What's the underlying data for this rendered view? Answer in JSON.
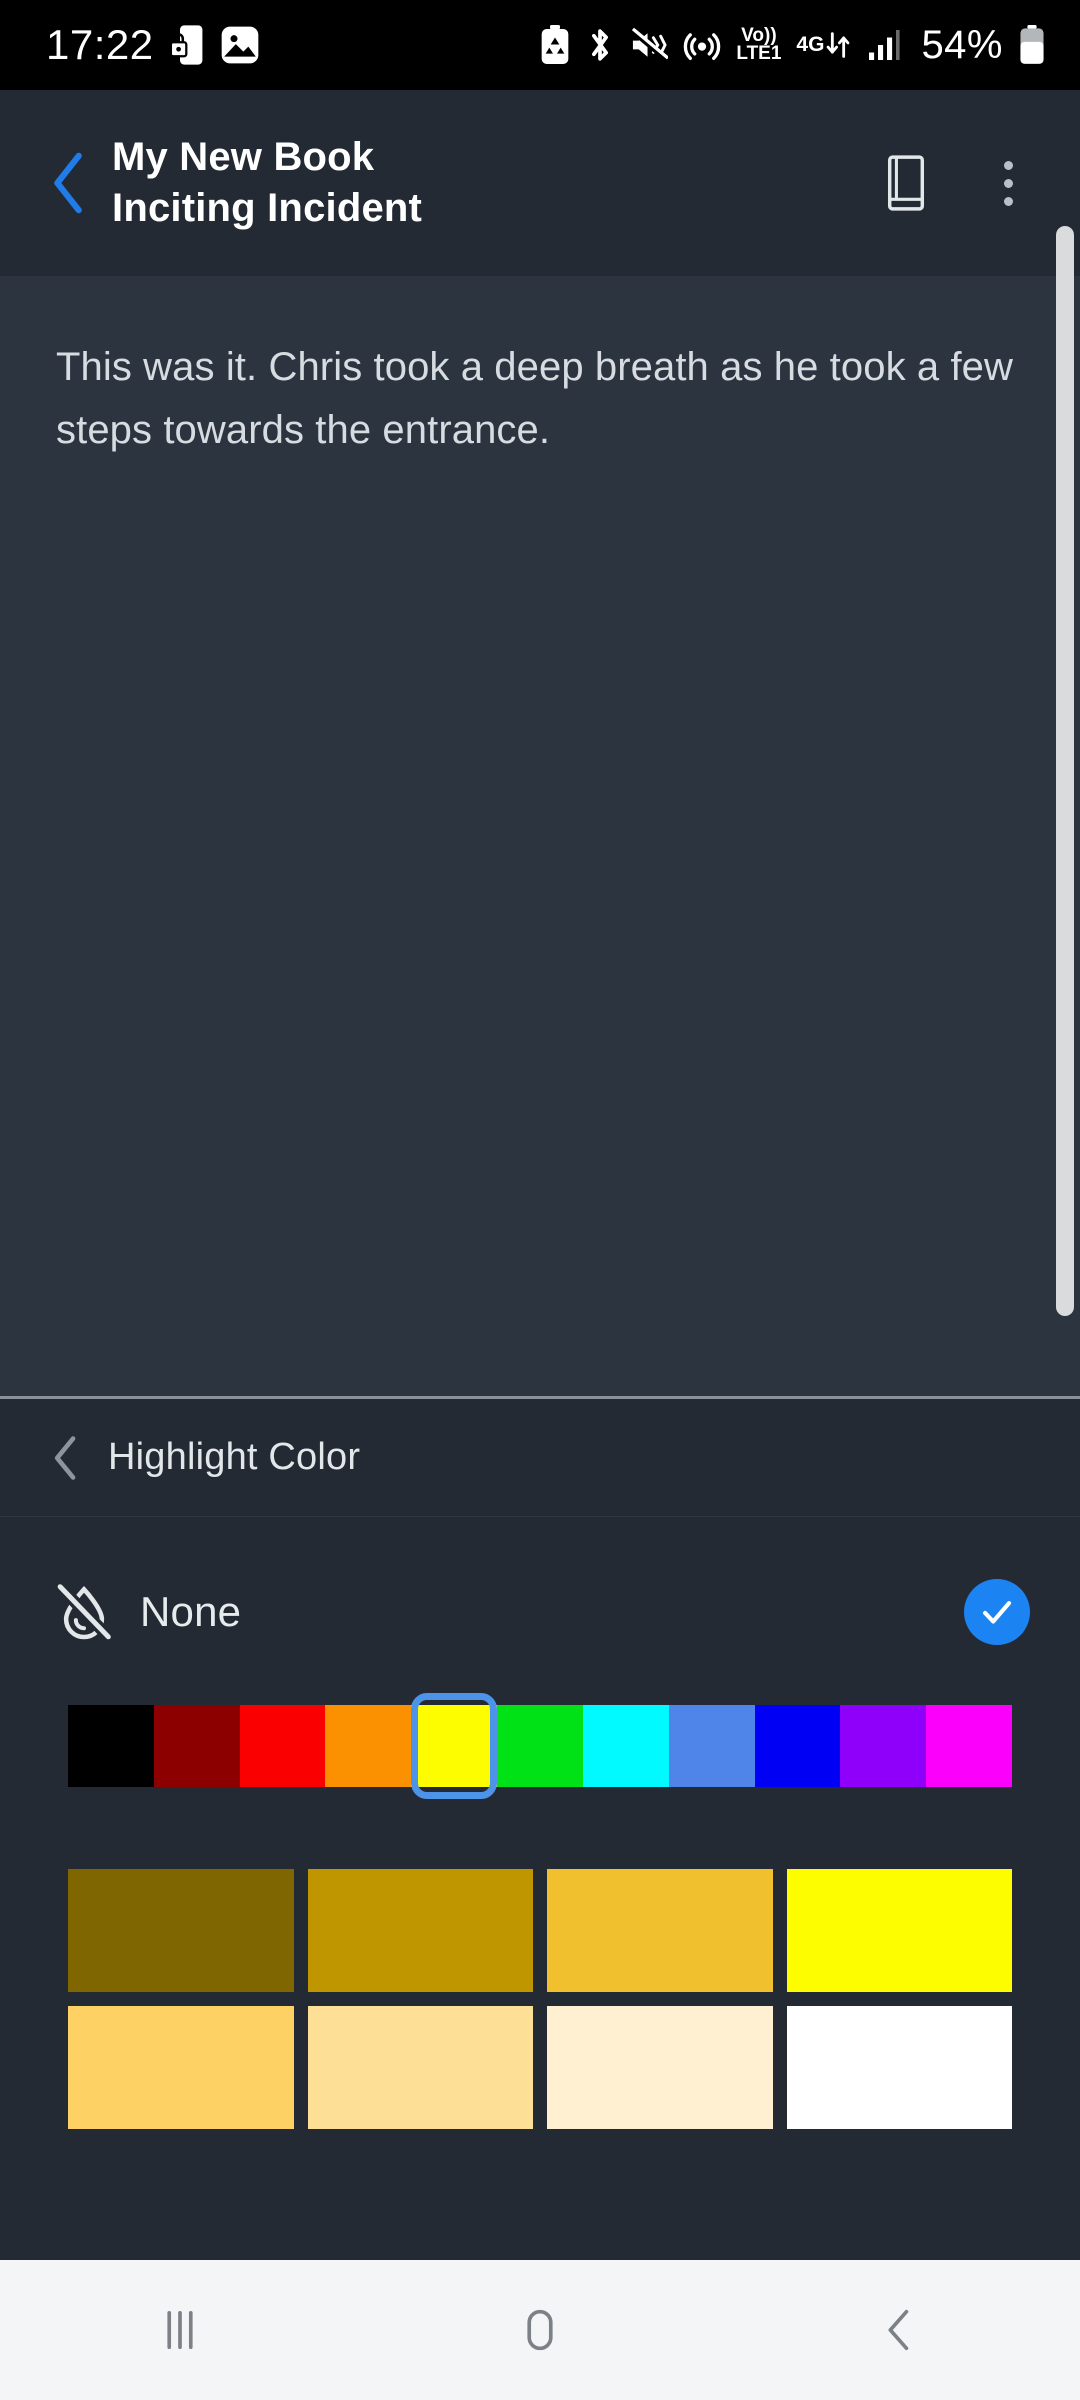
{
  "status_bar": {
    "time": "17:22",
    "battery_percent": "54%",
    "left_icons": [
      "phone-lock-icon",
      "gallery-image-icon"
    ],
    "right_icons": [
      "battery-saver-icon",
      "bluetooth-icon",
      "mute-vibrate-icon",
      "hotspot-icon"
    ],
    "volte_label_top": "Vo))",
    "volte_label_bottom": "LTE1",
    "network_type": "4G",
    "signal_icon": "signal-bars-icon"
  },
  "app_bar": {
    "back_label": "‹",
    "book_title": "My New Book",
    "chapter_title": "Inciting Incident",
    "book_icon": "book-icon",
    "overflow_icon": "more-vertical-icon"
  },
  "editor": {
    "body_text": "This was it. Chris took a deep breath as he took a few steps towards the entrance."
  },
  "highlight_panel": {
    "back_label": "‹",
    "title": "Highlight Color",
    "none_label": "None",
    "none_icon": "highlight-off-icon",
    "none_selected": true,
    "check_icon": "check-icon",
    "accent_color": "#1c84f2",
    "selected_hue_index": 4,
    "hues": [
      {
        "name": "black",
        "hex": "#000000"
      },
      {
        "name": "dark-red",
        "hex": "#8c0000"
      },
      {
        "name": "red",
        "hex": "#fa0000"
      },
      {
        "name": "orange",
        "hex": "#fb9000"
      },
      {
        "name": "yellow",
        "hex": "#fdfd00"
      },
      {
        "name": "green",
        "hex": "#00e215"
      },
      {
        "name": "cyan",
        "hex": "#00faff"
      },
      {
        "name": "cornflower",
        "hex": "#4f85e8"
      },
      {
        "name": "blue",
        "hex": "#0000f5"
      },
      {
        "name": "violet",
        "hex": "#8f00fb"
      },
      {
        "name": "magenta",
        "hex": "#fb00fb"
      }
    ],
    "shade_rows": [
      [
        {
          "name": "dark-olive",
          "hex": "#806600"
        },
        {
          "name": "dark-gold",
          "hex": "#bf9500"
        },
        {
          "name": "gold",
          "hex": "#f0c02e"
        },
        {
          "name": "pure-yellow",
          "hex": "#fdfd00"
        }
      ],
      [
        {
          "name": "light-gold",
          "hex": "#fdd163"
        },
        {
          "name": "pale-gold",
          "hex": "#fde096"
        },
        {
          "name": "cream",
          "hex": "#fef0d0"
        },
        {
          "name": "white",
          "hex": "#ffffff"
        }
      ]
    ]
  },
  "nav_bar": {
    "recents_icon": "recents-icon",
    "home_icon": "home-icon",
    "back_icon": "back-chevron-icon"
  }
}
